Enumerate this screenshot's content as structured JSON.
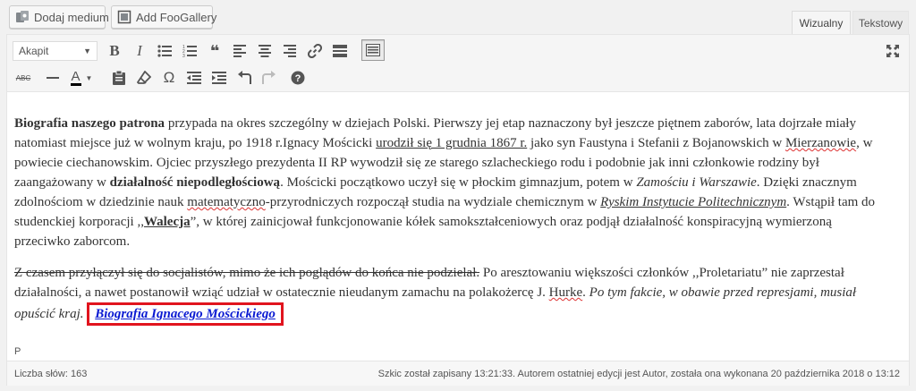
{
  "media_buttons": {
    "add_media": "Dodaj medium",
    "add_foogallery": "Add FooGallery"
  },
  "tabs": {
    "visual": "Wizualny",
    "text": "Tekstowy"
  },
  "toolbar": {
    "format_select": "Akapit",
    "row1_icons": [
      "bold-icon",
      "italic-icon",
      "bullet-list-icon",
      "numbered-list-icon",
      "blockquote-icon",
      "align-left-icon",
      "align-center-icon",
      "align-right-icon",
      "insert-link-icon",
      "read-more-icon",
      "toolbar-toggle-icon"
    ],
    "row2_icons": [
      "strikethrough-icon",
      "horizontal-line-icon",
      "text-color-icon",
      "paste-text-icon",
      "clear-formatting-icon",
      "special-character-icon",
      "outdent-icon",
      "indent-icon",
      "undo-icon",
      "redo-icon",
      "help-icon"
    ],
    "bold_label": "B",
    "italic_label": "I",
    "omega_label": "Ω",
    "strike_label": "ABC",
    "text_color_label": "A"
  },
  "content": {
    "p1": {
      "s1_bold": "Biografia naszego patrona",
      "s2": " przypada na okres szczególny w dziejach Polski. Pierwszy jej etap naznaczony był jeszcze piętnem zaborów, lata dojrzałe miały natomiast miejsce już w wolnym kraju, po 1918 r.Ignacy Mościcki ",
      "s3_underlined": "urodził się 1 grudnia 1867 r.",
      "s4": " jako syn Faustyna i Stefanii z Bojanowskich w ",
      "s5_spell": "Mierzanowie",
      "s6": ", w powiecie ciechanowskim. Ojciec przyszłego prezydenta II RP wywodził się ze starego szlacheckiego rodu i podobnie jak inni członkowie rodziny był zaangażowany w ",
      "s7_bold": "działalność niepodległościową",
      "s8": ". Mościcki początkowo uczył się w płockim gimnazjum, potem w ",
      "s9_italic": "Zamościu i Warszawie",
      "s10": ". Dzięki znacznym zdolnościom w dziedzinie nauk ",
      "s11_spell": "matematyczno",
      "s12": "-przyrodniczych rozpoczął studia na wydziale chemicznym w ",
      "s13_italic_underlined": "Ryskim Instytucie Politechnicznym",
      "s14": ". Wstąpił tam do studenckiej korporacji ,,",
      "s15_bold_underlined": "Walecja",
      "s16": "”, w której zainicjował funkcjonowanie kółek samokształceniowych oraz podjął działalność konspiracyjną wymierzoną przeciwko zaborcom."
    },
    "p2": {
      "s1_strike": "Z czasem przyłączył się do socjalistów, mimo że ich poglądów do końca nie podzielał.",
      "s2": " Po aresztowaniu większości członków ,,Proletariatu” nie zaprzestał działalności, a nawet postanowił wziąć udział w ostatecznie nieudanym zamachu na polakożercę J. ",
      "s3_spell": "Hurke",
      "s4": ". ",
      "s5_italic": "Po tym fakcie, w obawie przed represjami, musiał opuścić kraj.",
      "link_text": "Biografia Ignacego Mościckiego"
    }
  },
  "path_label": "P",
  "status": {
    "word_count": "Liczba słów: 163",
    "saved": "Szkic został zapisany 13:21:33. Autorem ostatniej edycji jest Autor, została ona wykonana 20 października 2018 o 13:12"
  },
  "colors": {
    "link": "#0a1ad2",
    "highlight_box": "#e1141e"
  }
}
